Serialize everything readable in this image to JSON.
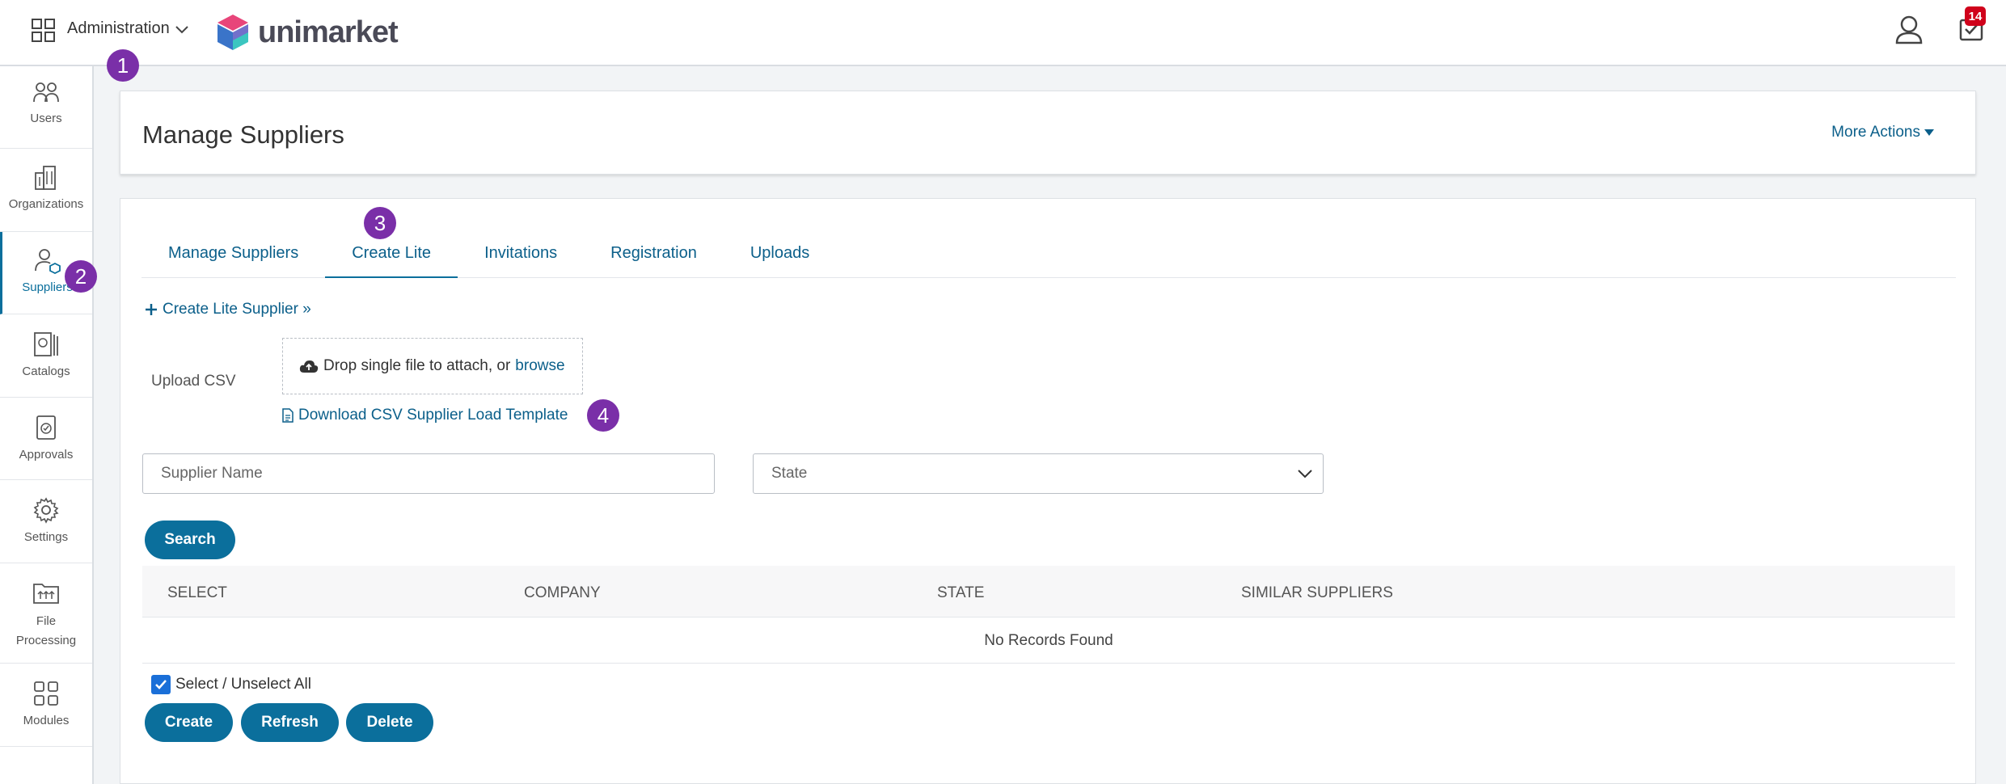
{
  "header": {
    "module_label": "Administration",
    "brand": "unimarket",
    "inbox_count": "14"
  },
  "sidebar": {
    "items": [
      {
        "label": "Users",
        "icon": "users-icon"
      },
      {
        "label": "Organizations",
        "icon": "building-icon"
      },
      {
        "label": "Suppliers",
        "icon": "supplier-icon"
      },
      {
        "label": "Catalogs",
        "icon": "catalog-icon"
      },
      {
        "label": "Approvals",
        "icon": "approval-icon"
      },
      {
        "label": "Settings",
        "icon": "gear-icon"
      },
      {
        "label": "File\nProcessing",
        "icon": "file-processing-icon"
      },
      {
        "label": "Modules",
        "icon": "modules-icon"
      }
    ]
  },
  "steps": [
    "1",
    "2",
    "3",
    "4"
  ],
  "page": {
    "title": "Manage Suppliers",
    "more_actions": "More Actions"
  },
  "tabs": [
    "Manage Suppliers",
    "Create Lite",
    "Invitations",
    "Registration",
    "Uploads"
  ],
  "active_tab": "Create Lite",
  "create_form": {
    "create_link": "Create Lite Supplier »",
    "upload_label": "Upload CSV",
    "drop_text": "Drop single file to attach, or",
    "browse": "browse",
    "download_template": "Download CSV Supplier Load Template"
  },
  "filters": {
    "supplier_name_placeholder": "Supplier Name",
    "state_placeholder": "State",
    "search_button": "Search"
  },
  "table": {
    "columns": [
      "SELECT",
      "COMPANY",
      "STATE",
      "SIMILAR SUPPLIERS"
    ],
    "empty_message": "No Records Found"
  },
  "actions": {
    "select_all": "Select / Unselect All",
    "create": "Create",
    "refresh": "Refresh",
    "delete": "Delete"
  },
  "colors": {
    "primary": "#0b6f9c",
    "step_marker": "#7a2fa8",
    "badge": "#d0021b"
  }
}
